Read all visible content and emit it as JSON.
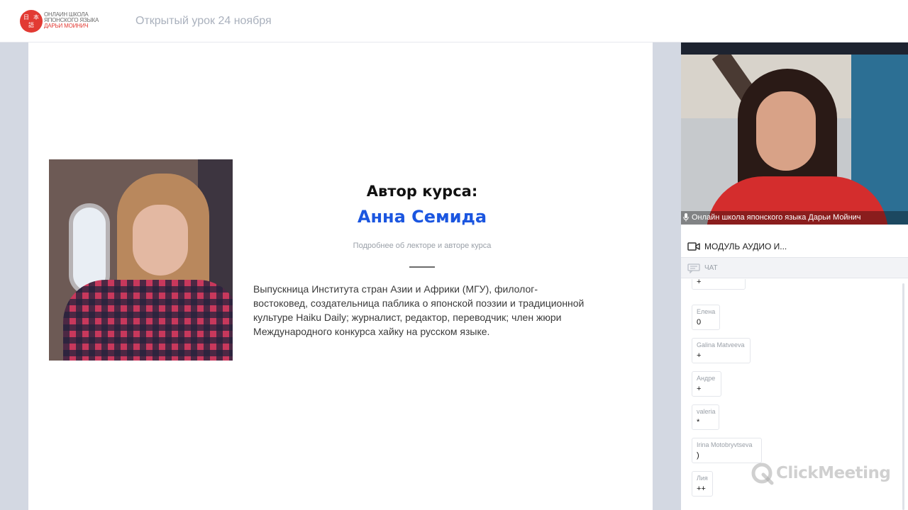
{
  "header": {
    "logo_lines": [
      "Онлайн школа",
      "японского языка",
      "Дарьи Мойнич"
    ],
    "logo_glyphs": [
      "日",
      "本",
      "語"
    ],
    "event_title": "Открытый урок 24 ноября"
  },
  "slide": {
    "author_label": "Автор курса:",
    "author_name": "Анна Семида",
    "subtitle": "Подробнее об лекторе и авторе курса",
    "bio": "Выпускница Института стран Азии и Африки (МГУ), филолог-востоковед, создательница паблика о японской поэзии и традиционной культуре Haiku Daily; журналист, редактор, переводчик; член жюри Международного конкурса хайку на русском языке."
  },
  "video": {
    "caption": "Онлайн школа японского языка Дарьи Мойнич"
  },
  "module": {
    "label": "МОДУЛЬ АУДИО И..."
  },
  "chat": {
    "label": "ЧАТ",
    "messages": [
      {
        "author": "",
        "text": "+"
      },
      {
        "author": "Елена",
        "text": "0"
      },
      {
        "author": "Galina Matveeva",
        "text": "+"
      },
      {
        "author": "Андре",
        "text": "+"
      },
      {
        "author": "valeria",
        "text": "*"
      },
      {
        "author": "Irina Motobryvtseva",
        "text": ")"
      },
      {
        "author": "Лия",
        "text": "++"
      }
    ]
  },
  "watermark": {
    "text": "ClickMeeting"
  },
  "colors": {
    "brand_red": "#e23a33",
    "accent_blue": "#1b56e0",
    "stage_bg": "#d3d8e2"
  }
}
